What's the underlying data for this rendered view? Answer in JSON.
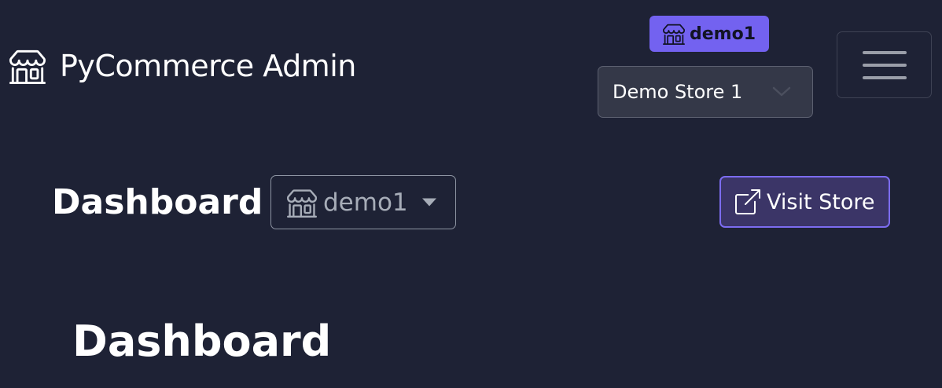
{
  "navbar": {
    "brand_icon": "shop-icon",
    "brand_text": "PyCommerce Admin",
    "store_badge": {
      "icon": "shop-icon",
      "label": "demo1",
      "color": "#7362f0"
    },
    "store_select": {
      "selected": "Demo Store 1",
      "icon": "chevron-down-icon"
    },
    "toggler_icon": "hamburger-icon"
  },
  "header": {
    "title": "Dashboard",
    "store_dropdown": {
      "icon": "shop-icon",
      "label": "demo1",
      "caret_icon": "caret-down-icon"
    },
    "visit_store": {
      "icon": "external-link-icon",
      "label": "Visit Store",
      "accent": "#7c6cf0"
    }
  },
  "main": {
    "heading": "Dashboard"
  },
  "colors": {
    "background": "#1e2235",
    "accent": "#7362f0"
  }
}
